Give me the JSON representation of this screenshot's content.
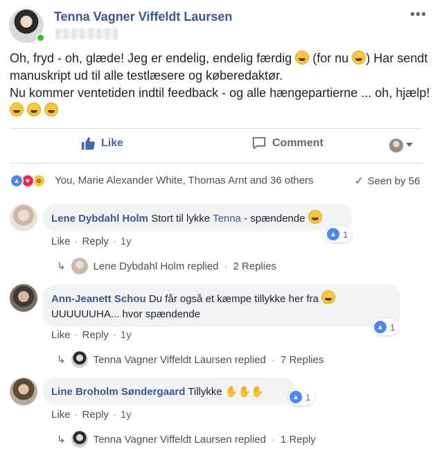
{
  "post": {
    "author": "Tenna Vagner Viffeldt Laursen",
    "more_icon": "ellipsis-icon",
    "body_lines": [
      "Oh, fryd - oh, glæde! Jeg er endelig, endelig færdig",
      "(for nu",
      ") Har sendt",
      "manuskript ud til alle testlæsere og køberedaktør.",
      "Nu kommer ventetiden indtil feedback - og alle hængepartierne ... oh, hjælp!"
    ]
  },
  "actions": {
    "like": "Like",
    "comment": "Comment"
  },
  "reactions": {
    "summary": "You, Marie Alexander White, Thomas Arnt and 36 others",
    "seen": "Seen by 56"
  },
  "comments": [
    {
      "name": "Lene Dybdahl Holm",
      "text": "Stort til lykke",
      "mention": "Tenna",
      "text2": "- spændende",
      "likes": "1",
      "meta": {
        "like": "Like",
        "reply": "Reply",
        "time": "1y"
      },
      "replies": {
        "who": "Lene Dybdahl Holm replied",
        "count": "2 Replies"
      }
    },
    {
      "name": "Ann-Jeanett Schou",
      "text": "Du får også et kæmpe tillykke her fra",
      "text_line2": "UUUUUUHA... hvor spændende",
      "likes": "1",
      "meta": {
        "like": "Like",
        "reply": "Reply",
        "time": "1y"
      },
      "replies": {
        "who": "Tenna Vagner Viffeldt Laursen replied",
        "count": "7 Replies"
      }
    },
    {
      "name": "Line Broholm Søndergaard",
      "text": "Tillykke",
      "likes": "1",
      "meta": {
        "like": "Like",
        "reply": "Reply",
        "time": "1y"
      },
      "replies": {
        "who": "Tenna Vagner Viffeldt Laursen replied",
        "count": "1 Reply"
      }
    }
  ],
  "colors": {
    "link_blue": "#365899",
    "like_blue": "#4267b2",
    "online_green": "#42b72a",
    "band_gray": "#f2f3f5"
  }
}
